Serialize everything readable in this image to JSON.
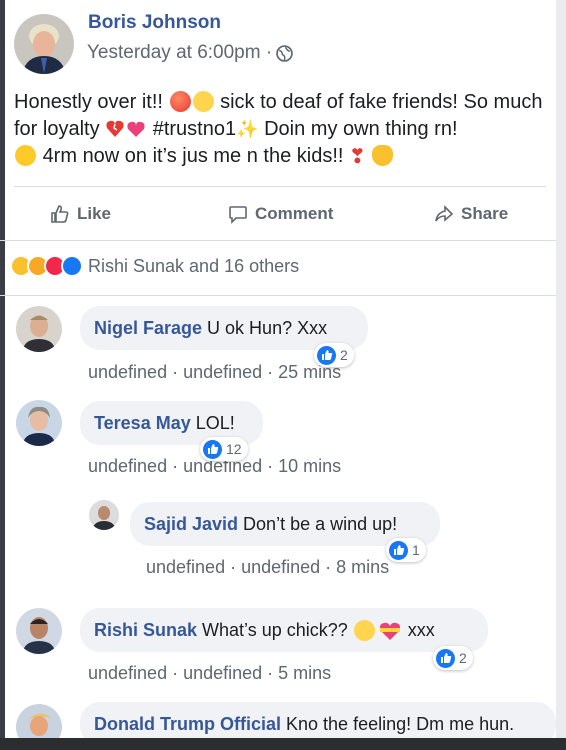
{
  "post": {
    "author": "Boris Johnson",
    "timestamp": "Yesterday at 6:00pm ·",
    "text_part1": "Honestly over it!!",
    "text_part2": "sick to deaf of fake friends! So much for loyalty",
    "text_part3": "#trustno1",
    "text_part4": "Doin my own thing rn!",
    "text_part5": "4rm now on it’s jus me n the kids!!"
  },
  "actions": {
    "like": "Like",
    "comment": "Comment",
    "share": "Share"
  },
  "reactions": {
    "summary": "Rishi Sunak and 16 others"
  },
  "comments": [
    {
      "name": "Nigel Farage",
      "text": "U ok Hun? Xxx",
      "meta": "undefined · undefined · 25 mins",
      "likes": "2"
    },
    {
      "name": "Teresa May",
      "text": "LOL!",
      "meta": "undefined · undefined · 10 mins",
      "likes": "12"
    },
    {
      "name": "Sajid Javid",
      "text": "Don’t be a wind up!",
      "meta": "undefined · undefined · 8 mins",
      "likes": "1"
    },
    {
      "name": "Rishi Sunak",
      "text": "What’s up chick??",
      "text_after": "xxx",
      "meta": "undefined · undefined · 5 mins",
      "likes": "2"
    },
    {
      "name": "Donald Trump Official",
      "text": "Kno the feeling! Dm me hun."
    }
  ],
  "colors": {
    "name_blue": "#365899",
    "meta_gray": "#606770",
    "bubble_gray": "#f0f2f5",
    "like_blue": "#1877f2"
  }
}
